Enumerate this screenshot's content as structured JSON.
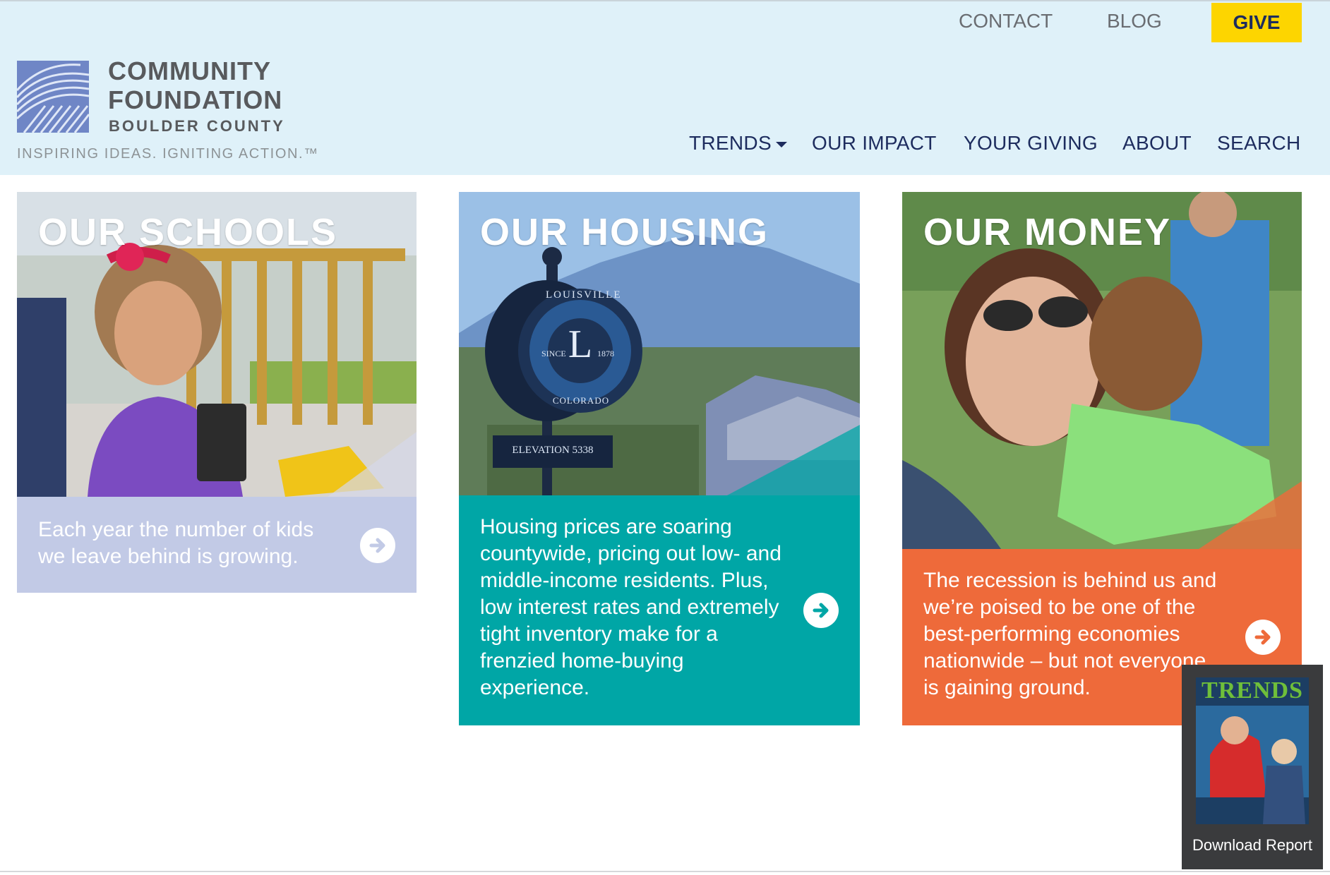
{
  "header": {
    "logo": {
      "name_line1": "COMMUNITY",
      "name_line2": "FOUNDATION",
      "subtitle": "BOULDER COUNTY",
      "tagline": "INSPIRING IDEAS. IGNITING ACTION.™"
    },
    "utility_nav": {
      "contact": "CONTACT",
      "blog": "BLOG",
      "give": "GIVE"
    },
    "main_nav": {
      "trends": "TRENDS",
      "our_impact": "OUR IMPACT",
      "your_giving": "YOUR GIVING",
      "about": "ABOUT",
      "search": "SEARCH"
    }
  },
  "cards": [
    {
      "title": "OUR SCHOOLS",
      "text": "Each year the number of kids we leave behind is growing.",
      "color": "#c2cae6"
    },
    {
      "title": "OUR HOUSING",
      "text": "Housing prices are soaring countywide, pricing out low- and middle-income residents. Plus, low interest rates and extremely tight inventory make for a frenzied home-buying experience.",
      "color": "#00a6a6",
      "sign": {
        "ring": "LOUISVILLE",
        "letter": "L",
        "since": "SINCE",
        "year": "1878",
        "state": "COLORADO",
        "elevation": "ELEVATION 5338"
      }
    },
    {
      "title": "OUR MONEY",
      "text": "The recession is behind us and we’re poised to be one of the best-performing economies nationwide – but not everyone is gaining ground.",
      "color": "#ee6a3a"
    }
  ],
  "report": {
    "label": "Download Report",
    "cover_title": "TRENDS"
  },
  "colors": {
    "header_bg": "#dff1f9",
    "navy": "#1d2c5e",
    "give_yellow": "#fdd500"
  }
}
